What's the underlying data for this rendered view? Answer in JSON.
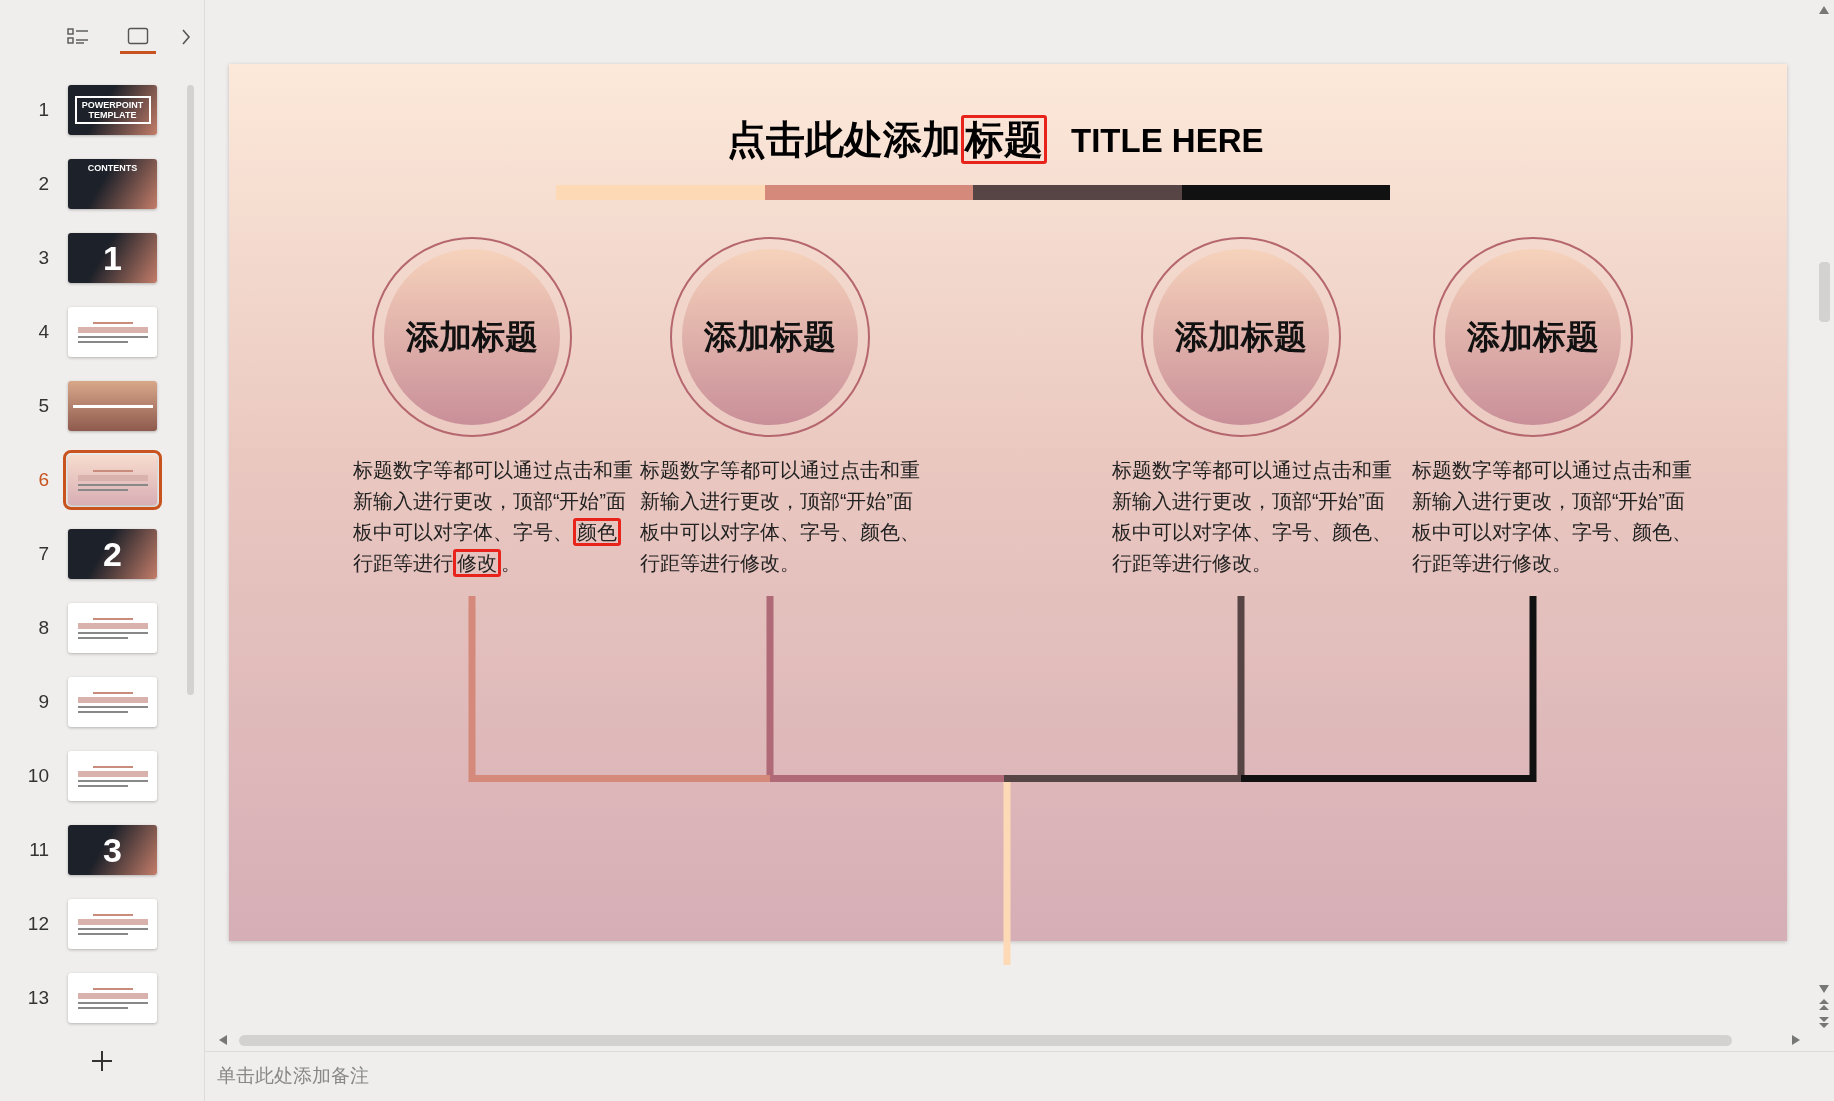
{
  "sidebar": {
    "view_tabs": [
      {
        "kind": "outline",
        "selected": false
      },
      {
        "kind": "slides",
        "selected": true
      }
    ],
    "slides": [
      {
        "number": "1",
        "kind": "title",
        "caption": "POWERPOINT TEMPLATE",
        "selected": false
      },
      {
        "number": "2",
        "kind": "contents",
        "caption": "CONTENTS",
        "selected": false
      },
      {
        "number": "3",
        "kind": "section",
        "caption": "1",
        "selected": false
      },
      {
        "number": "4",
        "kind": "content",
        "selected": false
      },
      {
        "number": "5",
        "kind": "photo",
        "selected": false
      },
      {
        "number": "6",
        "kind": "content",
        "selected": true
      },
      {
        "number": "7",
        "kind": "section",
        "caption": "2",
        "selected": false
      },
      {
        "number": "8",
        "kind": "content",
        "selected": false
      },
      {
        "number": "9",
        "kind": "content",
        "selected": false
      },
      {
        "number": "10",
        "kind": "content",
        "selected": false
      },
      {
        "number": "11",
        "kind": "section",
        "caption": "3",
        "selected": false
      },
      {
        "number": "12",
        "kind": "content",
        "selected": false
      },
      {
        "number": "13",
        "kind": "content",
        "selected": false
      }
    ]
  },
  "slide": {
    "title": [
      {
        "text": "点击此处添加",
        "highlighted": false
      },
      {
        "text": "标题",
        "highlighted": true
      }
    ],
    "title_en": "TITLE HERE",
    "items": [
      {
        "heading": "添加标题",
        "body": [
          {
            "text": "标题数字等都可以通过点击和重新输入进行更改，顶部“开始”面板中可以对字体、字号、",
            "highlighted": false
          },
          {
            "text": "颜色",
            "highlighted": true
          },
          {
            "text": "　行距等进行",
            "highlighted": false
          },
          {
            "text": "修改",
            "highlighted": true
          },
          {
            "text": "。",
            "highlighted": false
          }
        ],
        "color": "#d4897a"
      },
      {
        "heading": "添加标题",
        "body": [
          {
            "text": "标题数字等都可以通过点击和重新输入进行更改，顶部“开始”面板中可以对字体、字号、颜色、行距等进行修改。",
            "highlighted": false
          }
        ],
        "color": "#b06a77"
      },
      {
        "heading": "添加标题",
        "body": [
          {
            "text": "标题数字等都可以通过点击和重新输入进行更改，顶部“开始”面板中可以对字体、字号、颜色、行距等进行修改。",
            "highlighted": false
          }
        ],
        "color": "#574545"
      },
      {
        "heading": "添加标题",
        "body": [
          {
            "text": "标题数字等都可以通过点击和重新输入进行更改，顶部“开始”面板中可以对字体、字号、颜色、行距等进行修改。",
            "highlighted": false
          }
        ],
        "color": "#111111"
      }
    ]
  },
  "notes": {
    "placeholder": "单击此处添加备注"
  }
}
